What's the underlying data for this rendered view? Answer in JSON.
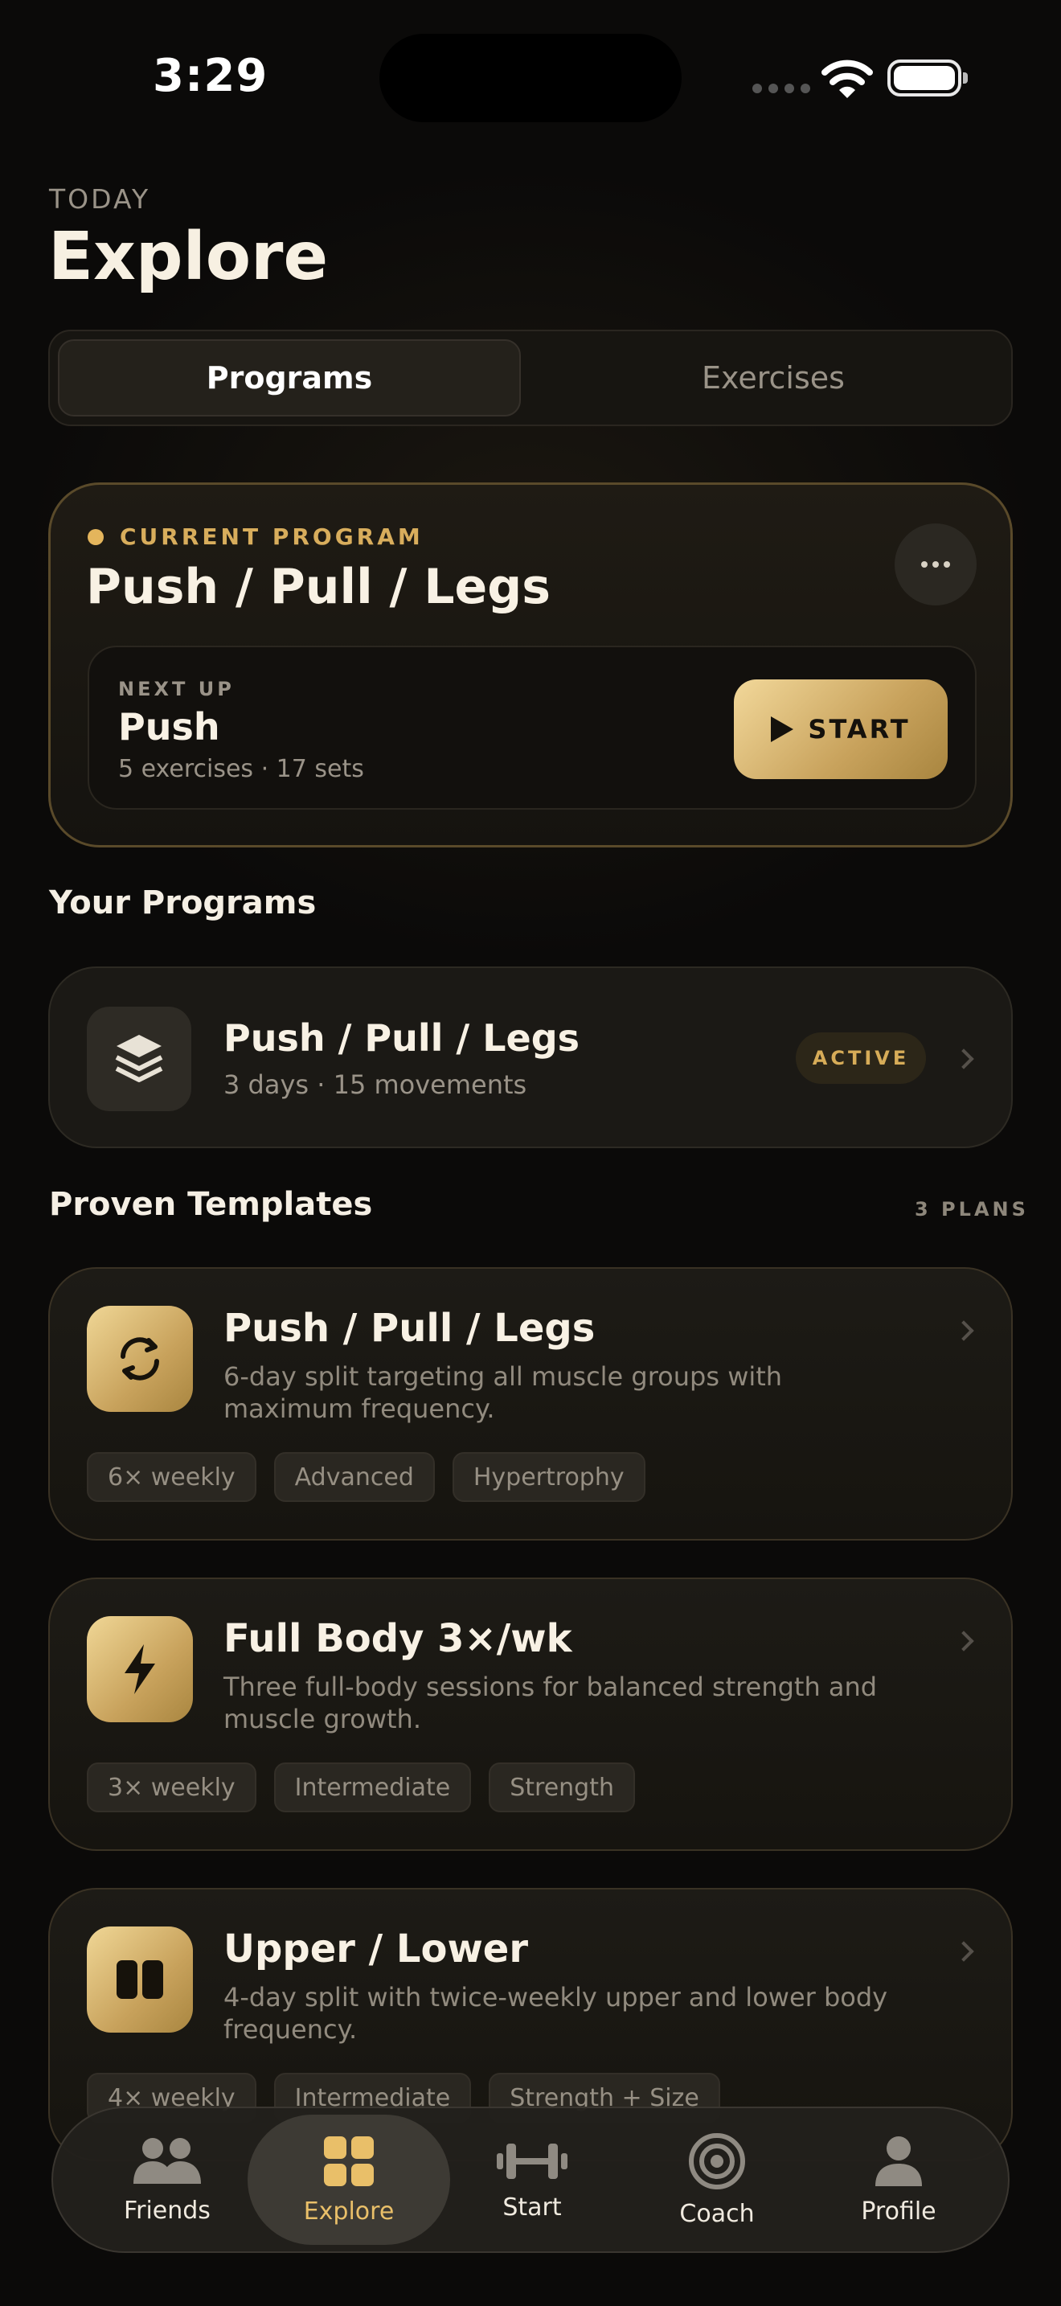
{
  "status": {
    "time": "3:29"
  },
  "header": {
    "eyebrow": "TODAY",
    "title": "Explore"
  },
  "segment": {
    "active": "Programs",
    "inactive": "Exercises"
  },
  "current_program": {
    "label": "CURRENT PROGRAM",
    "title": "Push / Pull / Legs",
    "next_up_label": "NEXT UP",
    "next_up_title": "Push",
    "next_up_sub": "5 exercises · 17 sets",
    "start_label": "START",
    "accent": "#e4b55c"
  },
  "your_programs": {
    "heading": "Your Programs",
    "items": [
      {
        "title": "Push / Pull / Legs",
        "sub": "3 days · 15 movements",
        "badge": "ACTIVE"
      }
    ]
  },
  "templates": {
    "heading": "Proven Templates",
    "count": "3 PLANS",
    "items": [
      {
        "title": "Push / Pull / Legs",
        "desc": "6-day split targeting all muscle groups with maximum frequency.",
        "tags": [
          "6× weekly",
          "Advanced",
          "Hypertrophy"
        ],
        "icon": "refresh-icon"
      },
      {
        "title": "Full Body 3×/wk",
        "desc": "Three full-body sessions for balanced strength and muscle growth.",
        "tags": [
          "3× weekly",
          "Intermediate",
          "Strength"
        ],
        "icon": "bolt-icon"
      },
      {
        "title": "Upper / Lower",
        "desc": "4-day split with twice-weekly upper and lower body frequency.",
        "tags": [
          "4× weekly",
          "Intermediate",
          "Strength + Size"
        ],
        "icon": "split-icon"
      }
    ]
  },
  "tabbar": {
    "items": [
      {
        "label": "Friends",
        "icon": "friends-icon"
      },
      {
        "label": "Explore",
        "icon": "grid-icon"
      },
      {
        "label": "Start",
        "icon": "dumbbell-icon"
      },
      {
        "label": "Coach",
        "icon": "target-icon"
      },
      {
        "label": "Profile",
        "icon": "person-icon"
      }
    ],
    "active": "Explore",
    "active_color": "#e9bf69"
  }
}
